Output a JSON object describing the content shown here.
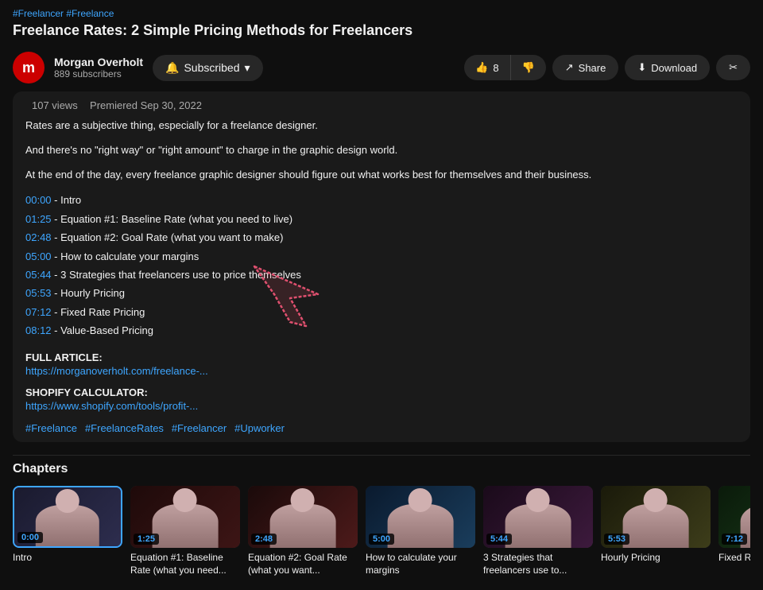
{
  "hashtags": "#Freelancer #Freelance",
  "video_title": "Freelance Rates: 2 Simple Pricing Methods for Freelancers",
  "channel": {
    "name": "Morgan Overholt",
    "subscribers": "889 subscribers",
    "avatar_letter": "m"
  },
  "subscribe_button": "Subscribed",
  "actions": {
    "like_count": "8",
    "like_label": "8",
    "share_label": "Share",
    "download_label": "Download"
  },
  "description": {
    "views": "107 views",
    "premiered": "Premiered Sep 30, 2022",
    "text1": "Rates are a subjective thing, especially for a freelance designer.",
    "text2": "And there's no \"right way\" or \"right amount\" to charge in the graphic design world.",
    "text3": "At the end of the day, every freelance graphic designer should figure out what works best for themselves and their business.",
    "timestamps": [
      {
        "time": "00:00",
        "label": "Intro"
      },
      {
        "time": "01:25",
        "label": "Equation #1: Baseline Rate (what you need to live)"
      },
      {
        "time": "02:48",
        "label": "Equation #2: Goal Rate (what you want to make)"
      },
      {
        "time": "05:00",
        "label": "How to calculate your margins"
      },
      {
        "time": "05:44",
        "label": "3 Strategies that freelancers use to price themselves"
      },
      {
        "time": "05:53",
        "label": "Hourly Pricing"
      },
      {
        "time": "07:12",
        "label": "Fixed Rate Pricing"
      },
      {
        "time": "08:12",
        "label": "Value-Based Pricing"
      }
    ],
    "full_article_label": "FULL ARTICLE:",
    "full_article_link": "https://morganoverholt.com/freelance-...",
    "shopify_label": "SHOPIFY CALCULATOR:",
    "shopify_link": "https://www.shopify.com/tools/profit-...",
    "hashtag_footer": "#Freelance #FreelanceRates #Freelancer #Upworker"
  },
  "chapters": {
    "title": "Chapters",
    "items": [
      {
        "time": "0:00",
        "label": "Intro",
        "color_class": "thumb-1"
      },
      {
        "time": "1:25",
        "label": "Equation #1: Baseline Rate (what you need...",
        "color_class": "thumb-2"
      },
      {
        "time": "2:48",
        "label": "Equation #2: Goal Rate (what you want...",
        "color_class": "thumb-3"
      },
      {
        "time": "5:00",
        "label": "How to calculate your margins",
        "color_class": "thumb-4"
      },
      {
        "time": "5:44",
        "label": "3 Strategies that freelancers use to...",
        "color_class": "thumb-5"
      },
      {
        "time": "5:53",
        "label": "Hourly Pricing",
        "color_class": "thumb-6"
      },
      {
        "time": "7:12",
        "label": "Fixed Rate P...",
        "color_class": "thumb-7"
      }
    ]
  }
}
